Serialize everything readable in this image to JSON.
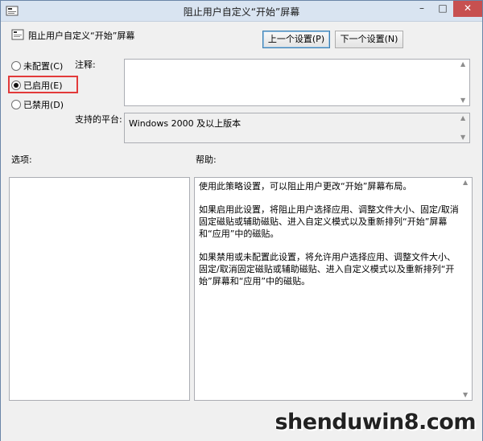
{
  "window": {
    "title": "阻止用户自定义“开始”屏幕"
  },
  "header": {
    "policy_title": "阻止用户自定义“开始”屏幕",
    "prev_button": "上一个设置(P)",
    "next_button": "下一个设置(N)"
  },
  "state": {
    "options": [
      {
        "label": "未配置(C)",
        "checked": false
      },
      {
        "label": "已启用(E)",
        "checked": true
      },
      {
        "label": "已禁用(D)",
        "checked": false
      }
    ]
  },
  "comment": {
    "label": "注释:",
    "value": ""
  },
  "platform": {
    "label": "支持的平台:",
    "value": "Windows 2000 及以上版本"
  },
  "options_panel": {
    "label": "选项:"
  },
  "help": {
    "label": "帮助:",
    "paragraphs": [
      "使用此策略设置，可以阻止用户更改“开始”屏幕布局。",
      "如果启用此设置，将阻止用户选择应用、调整文件大小、固定/取消固定磁贴或辅助磁贴、进入自定义模式以及重新排列“开始”屏幕和“应用”中的磁贴。",
      "如果禁用或未配置此设置，将允许用户选择应用、调整文件大小、固定/取消固定磁贴或辅助磁贴、进入自定义模式以及重新排列“开始”屏幕和“应用”中的磁贴。"
    ]
  },
  "watermark": {
    "text": "shenduwin8.com"
  },
  "colors": {
    "highlight": "#e23a3a",
    "close_button": "#c75050",
    "titlebar": "#d9e4f1"
  }
}
